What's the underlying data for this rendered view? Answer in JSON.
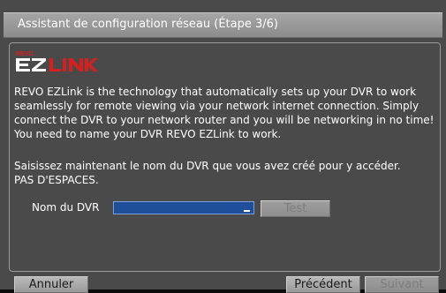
{
  "window": {
    "title": "Assistant de configuration réseau (Étape 3/6)"
  },
  "logo": {
    "small_text": "REVO",
    "big_text": "EZLINK",
    "colors": {
      "small": "#d61f1f",
      "ez": "#ffffff",
      "link": "#d61f1f"
    }
  },
  "content": {
    "intro": "REVO EZLink is the technology that automatically sets up your DVR to work seamlessly for remote viewing via your network internet connection. Simply connect the DVR to your network router and you will be networking in no time! You need to name your DVR REVO EZLink to work.",
    "instruction_line1": "Saisissez maintenant le nom du DVR que vous avez créé pour y accéder.",
    "instruction_line2": "PAS D'ESPACES."
  },
  "form": {
    "dvr_name_label": "Nom du DVR",
    "dvr_name_value": "",
    "test_label": "Test"
  },
  "footer": {
    "cancel_label": "Annuler",
    "previous_label": "Précédent",
    "next_label": "Suivant"
  },
  "colors": {
    "input_bg": "#1f4f9a",
    "window_bg": "#4a4a4a"
  }
}
